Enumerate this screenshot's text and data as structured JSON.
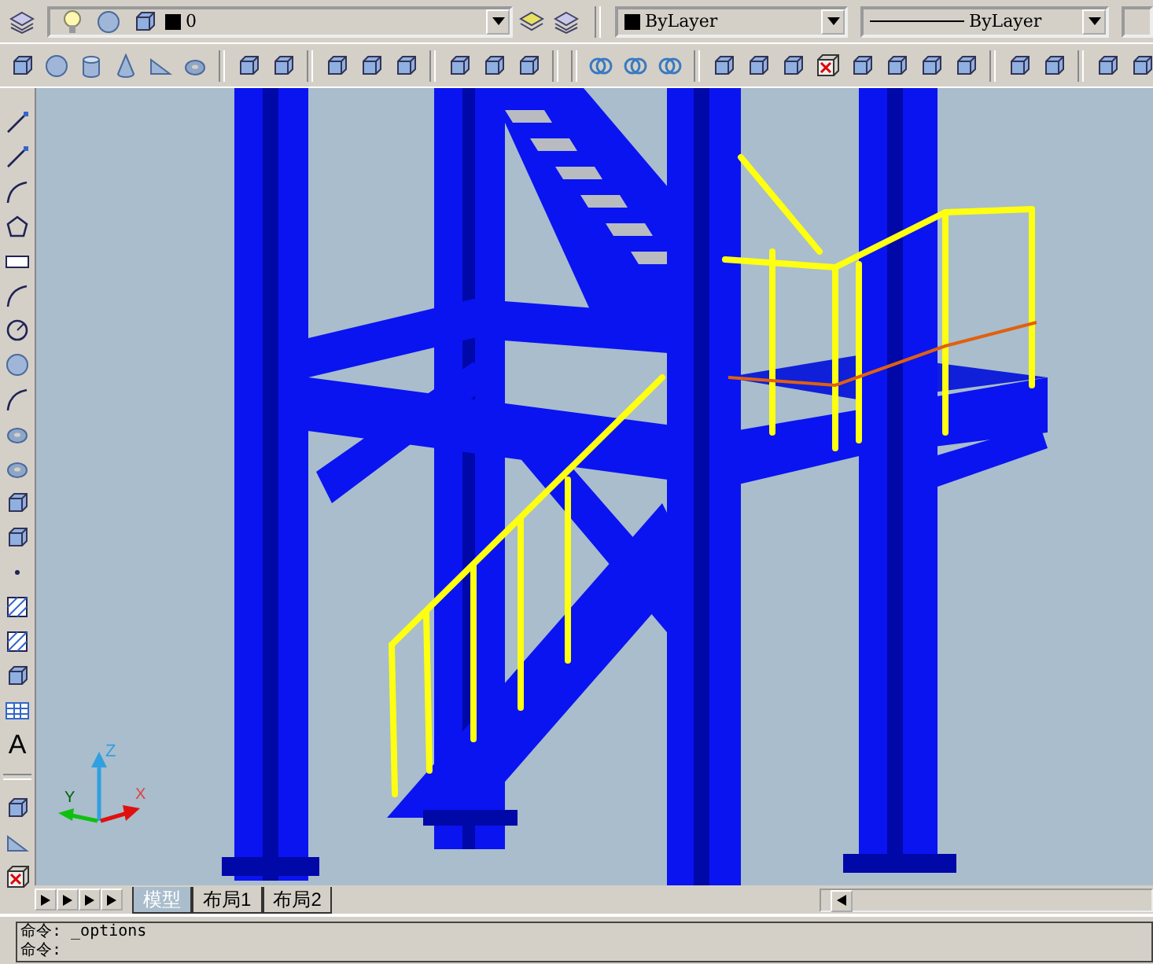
{
  "layers_toolbar": {
    "layer_name": "0"
  },
  "properties_toolbar": {
    "color_setting": "ByLayer",
    "linetype": "ByLayer"
  },
  "draw_toolbar": {
    "text_glyph": "A"
  },
  "ucs_icon": {
    "z": "Z",
    "y": "Y",
    "x": "X"
  },
  "layout_tabs": [
    {
      "label": "模型",
      "selected": true
    },
    {
      "label": "布局1",
      "selected": false
    },
    {
      "label": "布局2",
      "selected": false
    }
  ],
  "command_lines": [
    "命令: _options",
    "命令:"
  ]
}
